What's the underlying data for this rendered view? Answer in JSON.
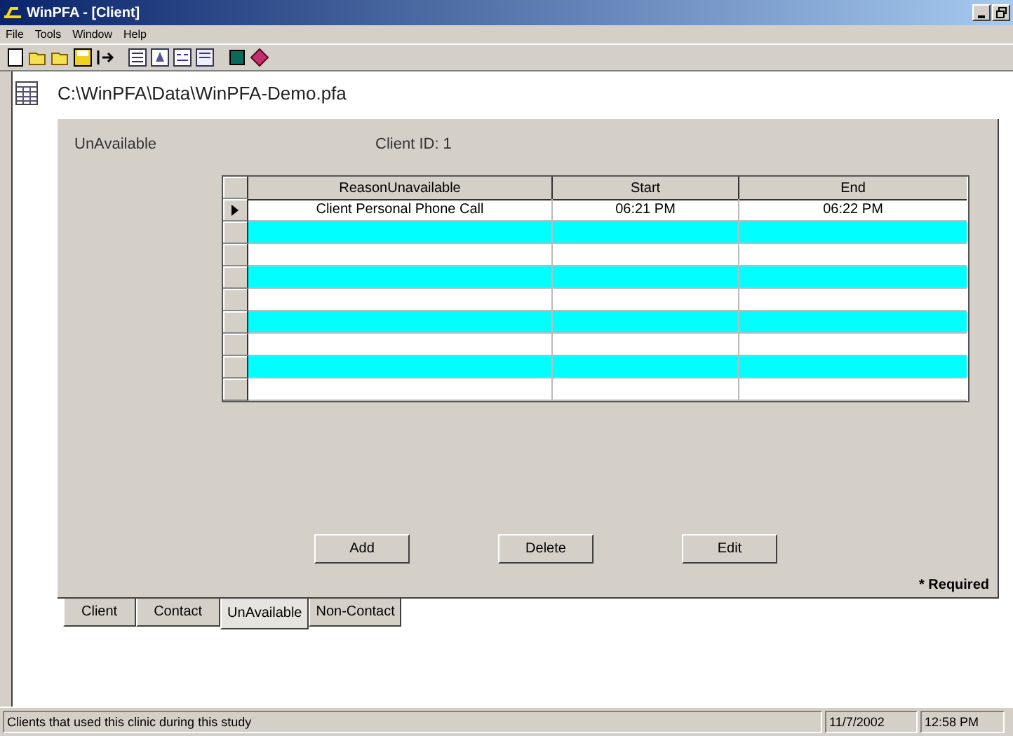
{
  "window": {
    "title": "WinPFA - [Client]"
  },
  "menu": [
    "File",
    "Tools",
    "Window",
    "Help"
  ],
  "path": "C:\\WinPFA\\Data\\WinPFA-Demo.pfa",
  "panel": {
    "title": "UnAvailable",
    "client_id": "Client ID:  1"
  },
  "table": {
    "columns": [
      "ReasonUnavailable",
      "Start",
      "End"
    ],
    "rows": [
      {
        "selected": true,
        "cells": [
          "Client Personal Phone Call",
          "06:21 PM",
          "06:22 PM"
        ]
      },
      {
        "selected": false
      },
      {
        "selected": false
      },
      {
        "selected": false
      },
      {
        "selected": false
      },
      {
        "selected": false
      },
      {
        "selected": false
      },
      {
        "selected": false
      },
      {
        "selected": false
      }
    ]
  },
  "buttons": [
    "Add",
    "Delete",
    "Edit"
  ],
  "required_note": "* Required",
  "tabs": [
    {
      "label": "Client",
      "selected": false
    },
    {
      "label": "Contact",
      "selected": false
    },
    {
      "label": "UnAvailable",
      "selected": true
    },
    {
      "label": "Non-Contact",
      "selected": false
    }
  ],
  "status_bar": {
    "message": "Clients that used this clinic during this study",
    "date": "11/7/2002",
    "time": "12:58 PM"
  }
}
